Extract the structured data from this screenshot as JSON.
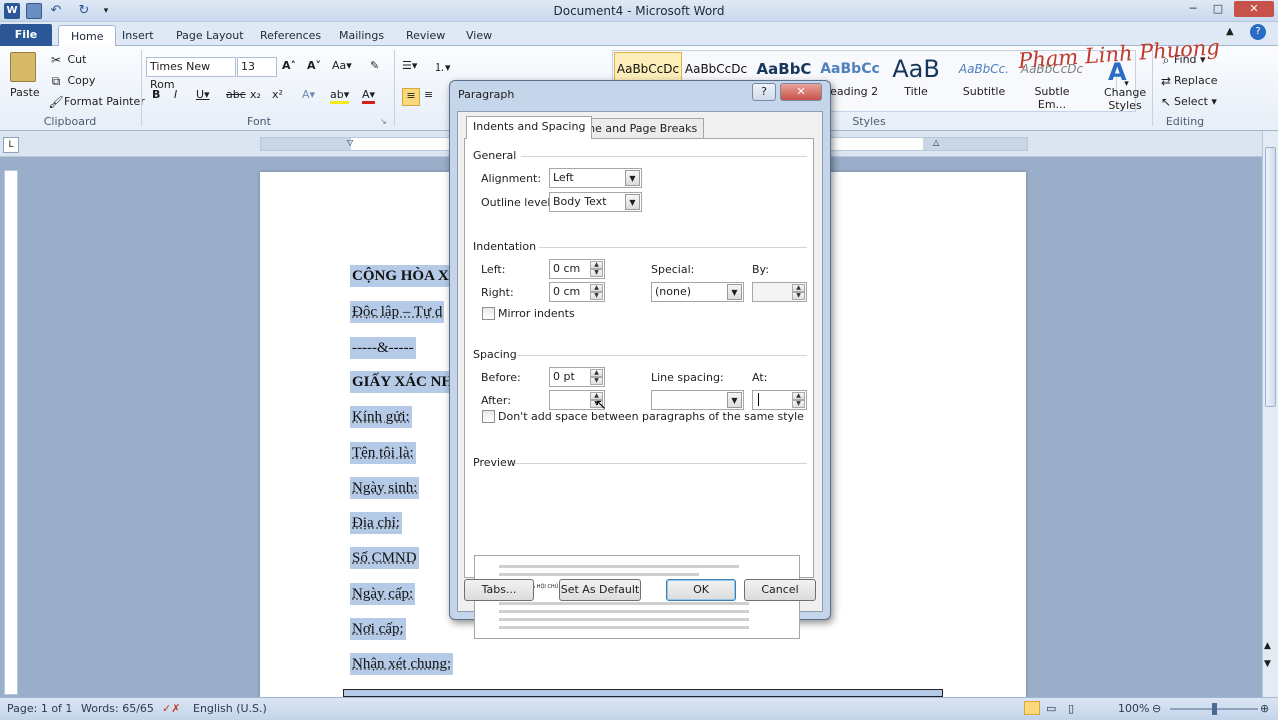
{
  "window": {
    "title": "Document4 - Microsoft Word",
    "min": "─",
    "max": "□",
    "close": "✕"
  },
  "tabs": [
    "File",
    "Home",
    "Insert",
    "Page Layout",
    "References",
    "Mailings",
    "Review",
    "View"
  ],
  "clipboard": {
    "paste": "Paste",
    "cut": "Cut",
    "copy": "Copy",
    "format_painter": "Format Painter",
    "label": "Clipboard"
  },
  "font": {
    "name": "Times New Rom",
    "size": "13",
    "label": "Font"
  },
  "styles": {
    "items": [
      {
        "sample": "AaBbCcDc",
        "name": ""
      },
      {
        "sample": "AaBbCcDc",
        "name": ""
      },
      {
        "sample": "AaBbC",
        "name": ""
      },
      {
        "sample": "AaBbCc",
        "name": "Heading 2"
      },
      {
        "sample": "AaB",
        "name": "Title"
      },
      {
        "sample": "AaBbCc.",
        "name": "Subtitle"
      },
      {
        "sample": "AaBbCcDc",
        "name": "Subtle Em..."
      }
    ],
    "change": "Change Styles",
    "label": "Styles"
  },
  "editing": {
    "find": "Find",
    "replace": "Replace",
    "select": "Select",
    "label": "Editing"
  },
  "watermark": "Pham Linh Phuong",
  "document": {
    "lines": [
      "CỘNG HÒA XÃ",
      "Độc lập – Tự d",
      "-----&-----",
      "GIẤY XÁC NH",
      "Kính gửi:",
      "Tên tôi là:",
      "Ngày sinh:",
      "Địa chỉ:",
      "Số CMND",
      "Ngày cấp:",
      "Nơi cấp:",
      "Nhận xét chung:"
    ]
  },
  "status": {
    "page": "Page: 1 of 1",
    "words": "Words: 65/65",
    "language": "English (U.S.)",
    "zoom": "100%"
  },
  "dialog": {
    "title": "Paragraph",
    "help": "?",
    "close": "✕",
    "tabs": [
      "Indents and Spacing",
      "Line and Page Breaks"
    ],
    "general": {
      "heading": "General",
      "alignment_label": "Alignment:",
      "alignment_value": "Left",
      "outline_label": "Outline level:",
      "outline_value": "Body Text"
    },
    "indentation": {
      "heading": "Indentation",
      "left_label": "Left:",
      "left_value": "0 cm",
      "right_label": "Right:",
      "right_value": "0 cm",
      "special_label": "Special:",
      "special_value": "(none)",
      "by_label": "By:",
      "mirror": "Mirror indents"
    },
    "spacing": {
      "heading": "Spacing",
      "before_label": "Before:",
      "before_value": "0 pt",
      "after_label": "After:",
      "after_value": "",
      "line_label": "Line spacing:",
      "line_value": "",
      "at_label": "At:",
      "at_value": "",
      "dont_add": "Don't add space between paragraphs of the same style"
    },
    "preview": {
      "heading": "Preview",
      "sample": "CỘNG HÒA XÃ HỘI CHỦ NGHĨA VIỆT NAM"
    },
    "buttons": {
      "tabs": "Tabs...",
      "default": "Set As Default",
      "ok": "OK",
      "cancel": "Cancel"
    }
  }
}
